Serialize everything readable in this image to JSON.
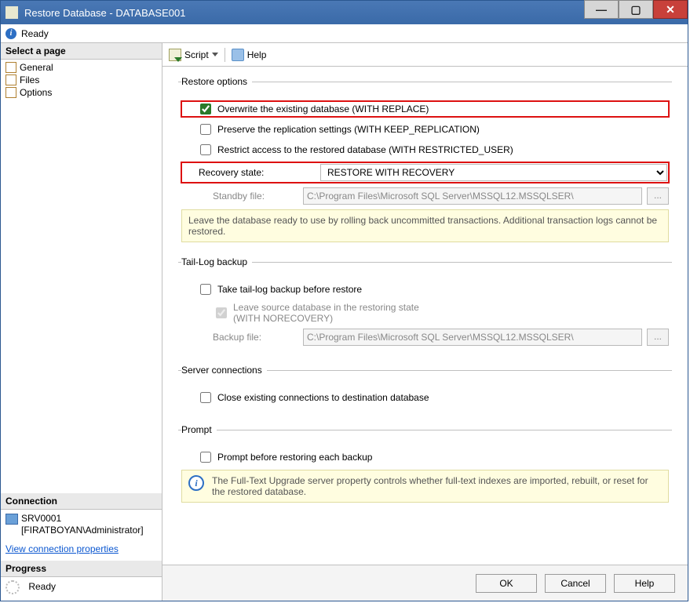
{
  "window": {
    "title": "Restore Database - DATABASE001"
  },
  "status": {
    "text": "Ready"
  },
  "sidebar": {
    "select_page": "Select a page",
    "items": [
      {
        "label": "General"
      },
      {
        "label": "Files"
      },
      {
        "label": "Options"
      }
    ],
    "connection_header": "Connection",
    "server": "SRV0001",
    "user": "[FIRATBOYAN\\Administrator]",
    "view_props": "View connection properties",
    "progress_header": "Progress",
    "progress_text": "Ready"
  },
  "toolbar": {
    "script": "Script",
    "help": "Help"
  },
  "restore_options": {
    "legend": "Restore options",
    "overwrite": "Overwrite the existing database (WITH REPLACE)",
    "preserve": "Preserve the replication settings (WITH KEEP_REPLICATION)",
    "restrict": "Restrict access to the restored database (WITH RESTRICTED_USER)",
    "recovery_label": "Recovery state:",
    "recovery_value": "RESTORE WITH RECOVERY",
    "standby_label": "Standby file:",
    "standby_value": "C:\\Program Files\\Microsoft SQL Server\\MSSQL12.MSSQLSER\\",
    "note": "Leave the database ready to use by rolling back uncommitted transactions. Additional transaction logs cannot be restored."
  },
  "taillog": {
    "legend": "Tail-Log backup",
    "take": "Take tail-log backup before restore",
    "leave": "Leave source database in the restoring state\n(WITH NORECOVERY)",
    "backup_label": "Backup file:",
    "backup_value": "C:\\Program Files\\Microsoft SQL Server\\MSSQL12.MSSQLSER\\"
  },
  "server_conn": {
    "legend": "Server connections",
    "close": "Close existing connections to destination database"
  },
  "prompt": {
    "legend": "Prompt",
    "before": "Prompt before restoring each backup",
    "info": "The Full-Text Upgrade server property controls whether full-text indexes are imported, rebuilt, or reset for the restored database."
  },
  "footer": {
    "ok": "OK",
    "cancel": "Cancel",
    "help": "Help"
  },
  "browse": "..."
}
